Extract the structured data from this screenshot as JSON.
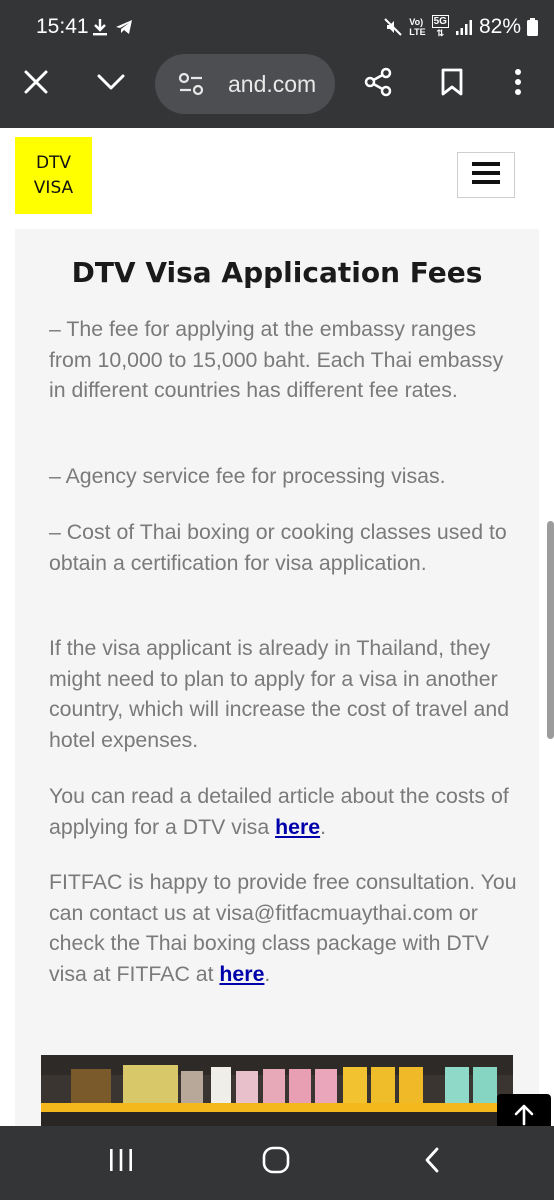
{
  "status_bar": {
    "time": "15:41",
    "battery_percent": "82%",
    "network_labels": [
      "Vo)",
      "LTE",
      "5G"
    ],
    "icons": [
      "download-icon",
      "telegram-icon",
      "mute-icon",
      "signal-icon",
      "battery-icon"
    ]
  },
  "browser": {
    "url_display": "and.com",
    "buttons": [
      "close-icon",
      "chevron-down-icon",
      "site-settings-icon",
      "share-icon",
      "bookmark-icon",
      "more-icon"
    ]
  },
  "site": {
    "logo_line1": "DTV",
    "logo_line2": "VISA",
    "menu_icon": "hamburger-icon"
  },
  "article": {
    "title": "DTV Visa Application Fees",
    "paragraphs": [
      "– The fee for applying at the embassy ranges from 10,000 to 15,000 baht. Each Thai embassy in different countries has different fee rates.",
      "– Agency service fee for processing visas.",
      "– Cost of Thai boxing or cooking classes used to obtain a certification for visa application.",
      "If the visa applicant is already in Thailand, they might need to plan to apply for a visa in another country, which will increase the cost of travel and hotel expenses."
    ],
    "para5_before": "You can read a detailed article about the costs of applying for a DTV visa ",
    "para5_link": "here",
    "para5_after": ".",
    "para6_before": "FITFAC is happy to provide free consultation. You can contact us at visa@fitfacmuaythai.com or check the Thai boxing class package with DTV visa at FITFAC at ",
    "para6_link": "here",
    "para6_after": "."
  },
  "colors": {
    "chrome_bg": "#333537",
    "logo_bg": "#ffff00",
    "card_bg": "#f5f5f5",
    "body_text": "#7a7a7a",
    "link": "#0000aa"
  },
  "navbar": {
    "buttons": [
      "recents-icon",
      "home-icon",
      "back-icon"
    ]
  }
}
